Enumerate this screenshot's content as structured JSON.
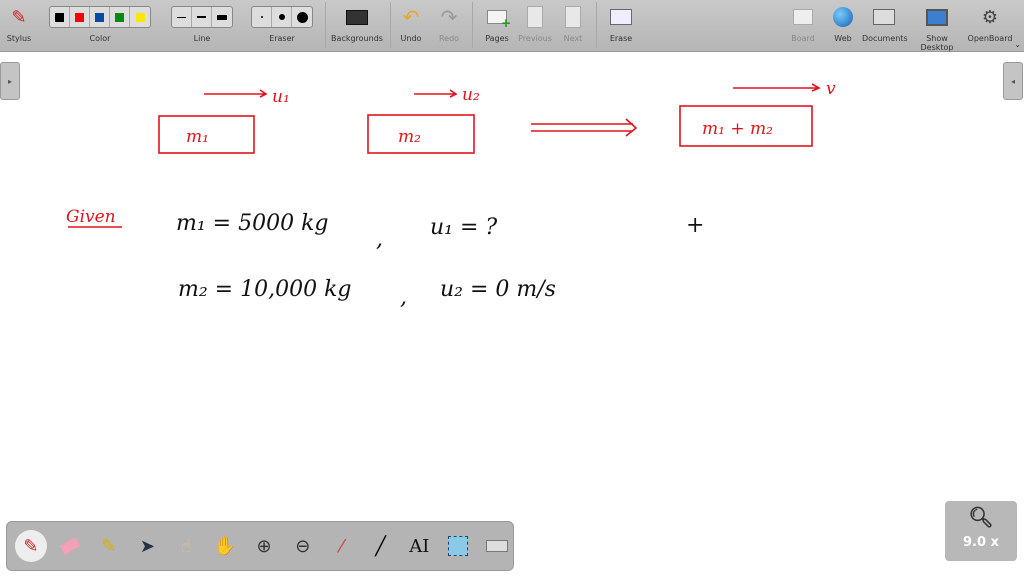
{
  "toolbar": {
    "stylus": "Stylus",
    "color": "Color",
    "line": "Line",
    "eraser": "Eraser",
    "backgrounds": "Backgrounds",
    "undo": "Undo",
    "redo": "Redo",
    "pages": "Pages",
    "previous": "Previous",
    "next": "Next",
    "erase": "Erase",
    "board": "Board",
    "web": "Web",
    "documents": "Documents",
    "show_desktop": "Show Desktop",
    "openboard": "OpenBoard",
    "colors": [
      "#000000",
      "#ff0000",
      "#0a4aa0",
      "#0a8a0a",
      "#ffe600"
    ]
  },
  "board": {
    "u1": "u₁",
    "u2": "u₂",
    "v": "v",
    "m1": "m₁",
    "m2": "m₂",
    "m1m2": "m₁ + m₂",
    "given": "Given",
    "line1a": "m₁ = 5000 kg",
    "line1b": "u₁ = ?",
    "line2a": "m₂ = 10,000 kg",
    "line2b": "u₂ = 0 m/s",
    "plus": "+",
    "comma": ","
  },
  "zoom": {
    "level": "9.0 x"
  },
  "ink_colors": {
    "red": "#e0141e",
    "black": "#111111"
  }
}
